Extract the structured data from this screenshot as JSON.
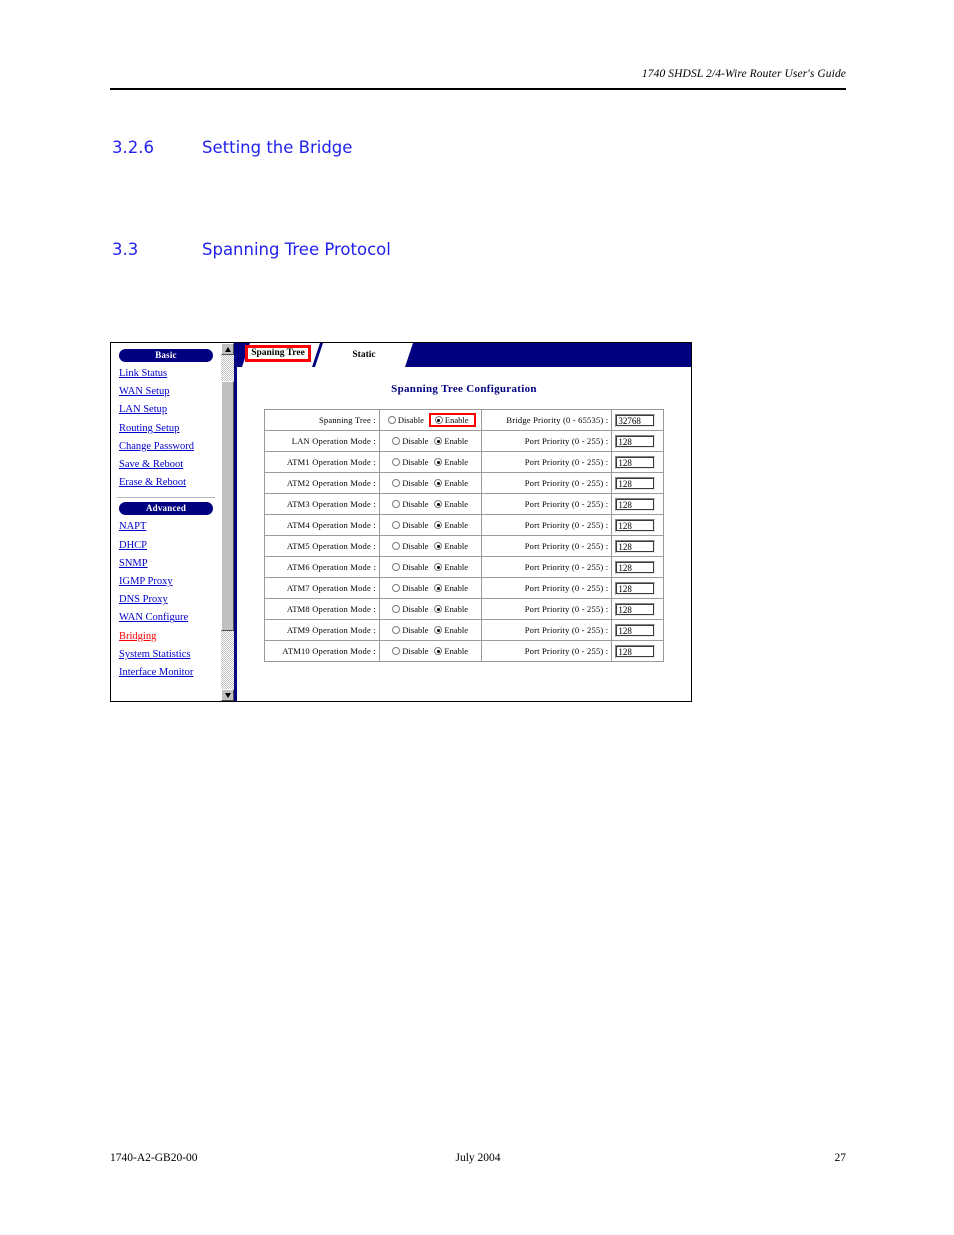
{
  "document": {
    "header_text": "1740 SHDSL 2/4-Wire Router User's Guide",
    "headings": [
      {
        "number": "3.2.6",
        "title": "Setting the Bridge"
      },
      {
        "number": "3.3",
        "title": "Spanning Tree Protocol"
      }
    ],
    "footer": {
      "doc_number": "1740-A2-GB20-00",
      "date": "July 2004",
      "page_number": "27"
    },
    "heading_color": "#2222ee"
  },
  "screenshot": {
    "accent_navy": "#000080",
    "link_color": "#0000cc",
    "active_link_color": "#ff0000",
    "annotation_color": "#ff0000",
    "sidebar": {
      "basic_label": "Basic",
      "basic_items": [
        {
          "label": "Link Status"
        },
        {
          "label": "WAN Setup"
        },
        {
          "label": "LAN Setup"
        },
        {
          "label": "Routing Setup"
        },
        {
          "label": "Change Password"
        },
        {
          "label": "Save & Reboot"
        },
        {
          "label": "Erase & Reboot"
        }
      ],
      "advanced_label": "Advanced",
      "advanced_items": [
        {
          "label": "NAPT"
        },
        {
          "label": "DHCP"
        },
        {
          "label": "SNMP"
        },
        {
          "label": "IGMP Proxy"
        },
        {
          "label": "DNS Proxy"
        },
        {
          "label": "WAN Configure"
        },
        {
          "label": "Bridging"
        },
        {
          "label": "System Statistics"
        },
        {
          "label": "Interface Monitor"
        }
      ]
    },
    "tabs": [
      {
        "label": "Spaning Tree",
        "active": true,
        "annotated": true
      },
      {
        "label": "Static",
        "active": false,
        "annotated": false
      }
    ],
    "panel_title": "Spanning Tree Configuration",
    "radio_options": {
      "disable": "Disable",
      "enable": "Enable"
    },
    "rows": [
      {
        "label": "Spanning Tree :",
        "selected": "Enable",
        "annotated": true,
        "priority_label": "Bridge Priority (0 - 65535) :",
        "priority_value": "32768"
      },
      {
        "label": "LAN Operation Mode :",
        "selected": "Enable",
        "annotated": false,
        "priority_label": "Port Priority (0 - 255) :",
        "priority_value": "128"
      },
      {
        "label": "ATM1 Operation Mode :",
        "selected": "Enable",
        "annotated": false,
        "priority_label": "Port Priority (0 - 255) :",
        "priority_value": "128"
      },
      {
        "label": "ATM2 Operation Mode :",
        "selected": "Enable",
        "annotated": false,
        "priority_label": "Port Priority (0 - 255) :",
        "priority_value": "128"
      },
      {
        "label": "ATM3 Operation Mode :",
        "selected": "Enable",
        "annotated": false,
        "priority_label": "Port Priority (0 - 255) :",
        "priority_value": "128"
      },
      {
        "label": "ATM4 Operation Mode :",
        "selected": "Enable",
        "annotated": false,
        "priority_label": "Port Priority (0 - 255) :",
        "priority_value": "128"
      },
      {
        "label": "ATM5 Operation Mode :",
        "selected": "Enable",
        "annotated": false,
        "priority_label": "Port Priority (0 - 255) :",
        "priority_value": "128"
      },
      {
        "label": "ATM6 Operation Mode :",
        "selected": "Enable",
        "annotated": false,
        "priority_label": "Port Priority (0 - 255) :",
        "priority_value": "128"
      },
      {
        "label": "ATM7 Operation Mode :",
        "selected": "Enable",
        "annotated": false,
        "priority_label": "Port Priority (0 - 255) :",
        "priority_value": "128"
      },
      {
        "label": "ATM8 Operation Mode :",
        "selected": "Enable",
        "annotated": false,
        "priority_label": "Port Priority (0 - 255) :",
        "priority_value": "128"
      },
      {
        "label": "ATM9 Operation Mode :",
        "selected": "Enable",
        "annotated": false,
        "priority_label": "Port Priority (0 - 255) :",
        "priority_value": "128"
      },
      {
        "label": "ATM10 Operation Mode :",
        "selected": "Enable",
        "annotated": false,
        "priority_label": "Port Priority (0 - 255) :",
        "priority_value": "128"
      }
    ]
  }
}
